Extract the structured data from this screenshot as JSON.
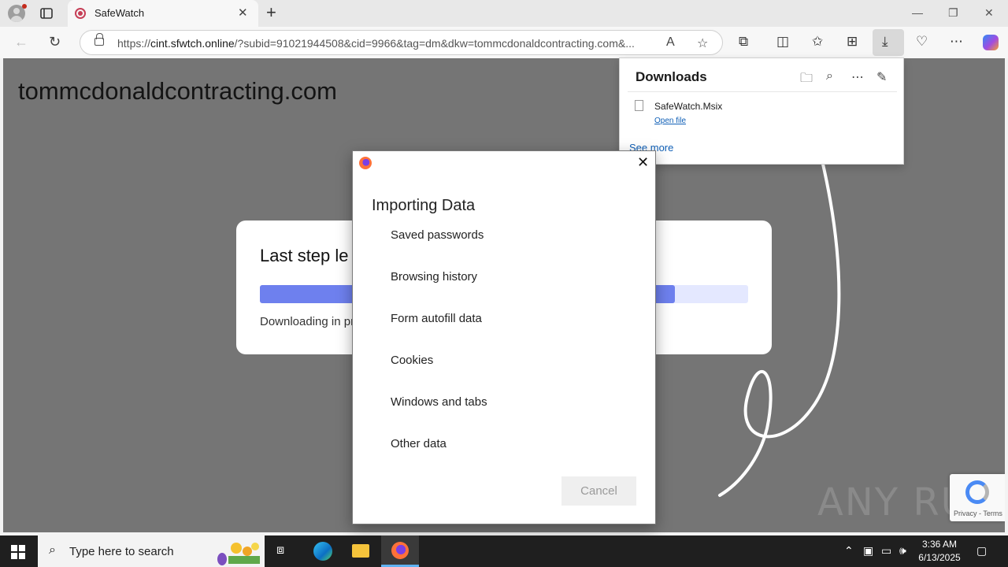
{
  "browser": {
    "tab_title": "SafeWatch",
    "new_tab_glyph": "+",
    "url_prefix": "https://",
    "url_host": "cint.sfwtch.online",
    "url_rest": "/?subid=91021944508&cid=9966&tag=dm&dkw=tommcdonaldcontracting.com&...",
    "icons": [
      "profile-icon",
      "tab-actions-icon",
      "back-icon",
      "refresh-icon",
      "lock-icon",
      "read-aloud-icon",
      "favorite-icon",
      "extensions-icon",
      "split-screen-icon",
      "favorites-icon",
      "collections-icon",
      "download-icon",
      "browser-essentials-icon",
      "more-icon",
      "copilot-icon"
    ]
  },
  "page": {
    "domain_heading": "tommcdonaldcontracting.com",
    "card_title": "Last step le",
    "card_status": "Downloading in pr",
    "progress_fraction": 0.85,
    "watermark": "ANY RUN",
    "recaptcha_links": "Privacy - Terms"
  },
  "downloads": {
    "title": "Downloads",
    "file_name": "SafeWatch.Msix",
    "open_link": "Open file",
    "see_more": "See more"
  },
  "dialog": {
    "title": "Importing Data",
    "items": [
      "Saved passwords",
      "Browsing history",
      "Form autofill data",
      "Cookies",
      "Windows and tabs",
      "Other data"
    ],
    "cancel_label": "Cancel"
  },
  "taskbar": {
    "search_placeholder": "Type here to search",
    "time": "3:36 AM",
    "date": "6/13/2025"
  },
  "colors": {
    "progress_fill": "#6e80ee",
    "progress_track": "#e4e8ff",
    "page_overlay": "#757575",
    "link": "#0f5fb6"
  }
}
